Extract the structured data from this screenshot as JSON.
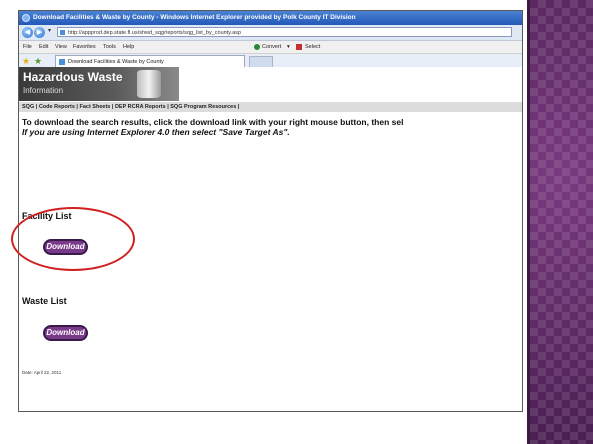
{
  "window": {
    "title": "Download Facilities & Waste by County - Windows Internet Explorer provided by Polk County IT Division",
    "address": "http://appprod.dep.state.fl.us/shwd_sqg/reports/sqg_list_by_county.asp"
  },
  "menu": {
    "file": "File",
    "edit": "Edit",
    "view": "View",
    "favorites": "Favorites",
    "tools": "Tools",
    "help": "Help",
    "convert": "Convert",
    "select": "Select"
  },
  "tab": {
    "label": "Download Facilities & Waste by County"
  },
  "banner": {
    "title": "Hazardous Waste",
    "subtitle": "Information"
  },
  "sitenav": {
    "links": "SQG | Code Reports | Fact Sheets | DEP RCRA Reports | SQG Program Resources |"
  },
  "content": {
    "instruction": "To download the search results, click the download link with your right mouse button, then sel",
    "instruction_ie": "If you are using Internet Explorer 4.0 then select \"Save Target As\".",
    "facility_title": "Facility List",
    "facility_button": "Download",
    "waste_title": "Waste List",
    "waste_button": "Download",
    "date": "Date: April 22, 2011"
  },
  "colors": {
    "accent_purple": "#5a2863",
    "highlight_red": "#d02020",
    "button_purple": "#7a3a8a"
  }
}
